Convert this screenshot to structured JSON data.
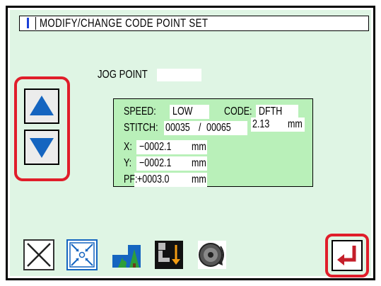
{
  "header": {
    "title": "MODIFY/CHANGE CODE   POINT SET"
  },
  "jog": {
    "label": "JOG POINT",
    "value": ""
  },
  "info": {
    "speed_label": "SPEED:",
    "speed_value": "LOW",
    "code_label": "CODE:",
    "code_value": "DFTH",
    "length_value": "2.13",
    "length_unit": "mm",
    "stitch_label": "STITCH:",
    "stitch_current": "00035",
    "stitch_separator": "/",
    "stitch_total": "00065",
    "x_label": "X:",
    "x_value": "−0002.1",
    "x_unit": "mm",
    "y_label": "Y:",
    "y_value": "−0002.1",
    "y_unit": "mm",
    "pf_label": "PF:",
    "pf_value": "+0003.0",
    "pf_unit": "mm"
  },
  "icons": {
    "up": "up-arrow-icon",
    "down": "down-arrow-icon",
    "cancel": "close-icon",
    "center": "center-point-icon",
    "tree": "tree-pattern-icon",
    "presser": "presser-foot-icon",
    "thread": "thread-wheel-icon",
    "enter": "enter-icon"
  },
  "colors": {
    "screen_bg": "#dff5e4",
    "panel_bg": "#b9f0b9",
    "arrow_blue": "#1565c0",
    "highlight_red": "#e01e2a",
    "enter_red": "#c41e2a"
  }
}
